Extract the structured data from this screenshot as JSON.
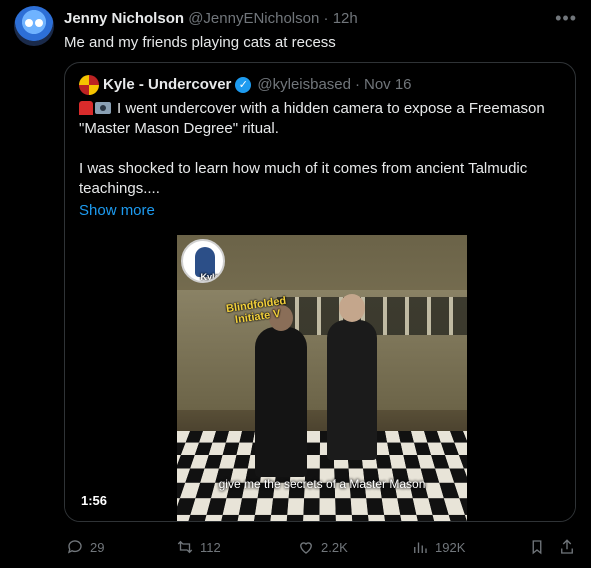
{
  "tweet": {
    "author_name": "Jenny Nicholson",
    "handle": "@JennyENicholson",
    "separator": "·",
    "time": "12h",
    "text": "Me and my friends playing cats at recess",
    "more_icon": "more-horizontal-icon"
  },
  "quote": {
    "author_name": "Kyle - Undercover",
    "handle": "@kyleisbased",
    "separator": "·",
    "date": "Nov 16",
    "body_line1": "I went undercover with a hidden camera to expose a Freemason \"Master Mason Degree\" ritual.",
    "body_line2": "I was shocked to learn how much of it comes from ancient Talmudic teachings....",
    "show_more": "Show more",
    "video": {
      "logo_text": "Kyle Undercover",
      "overlay_label": "Blindfolded Initiate V",
      "caption": "give me the secrets of a Master Mason",
      "duration": "1:56"
    }
  },
  "actions": {
    "replies": "29",
    "reposts": "112",
    "likes": "2.2K",
    "views": "192K"
  },
  "colors": {
    "accent": "#1d9bf0",
    "muted": "#71767b",
    "text": "#e7e9ea",
    "border": "#2f3336"
  }
}
